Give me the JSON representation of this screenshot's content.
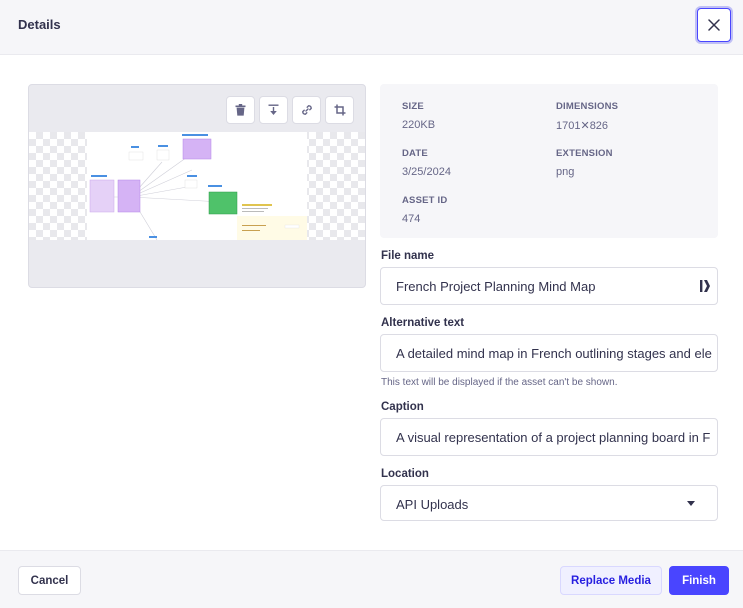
{
  "header": {
    "title": "Details",
    "close_icon": "close-icon"
  },
  "preview": {
    "toolbar": [
      {
        "name": "delete",
        "icon": "trash-icon"
      },
      {
        "name": "download",
        "icon": "download-icon"
      },
      {
        "name": "copy-link",
        "icon": "link-icon"
      },
      {
        "name": "crop",
        "icon": "crop-icon"
      }
    ]
  },
  "meta": {
    "size_label": "SIZE",
    "size_value": "220KB",
    "dimensions_label": "DIMENSIONS",
    "dimensions_value": "1701✕826",
    "date_label": "DATE",
    "date_value": "3/25/2024",
    "extension_label": "EXTENSION",
    "extension_value": "png",
    "asset_id_label": "ASSET ID",
    "asset_id_value": "474"
  },
  "form": {
    "file_name": {
      "label": "File name",
      "value": "French Project Planning Mind Map"
    },
    "alt_text": {
      "label": "Alternative text",
      "value": "A detailed mind map in French outlining stages and ele",
      "hint": "This text will be displayed if the asset can't be shown."
    },
    "caption": {
      "label": "Caption",
      "value": "A visual representation of a project planning board in F"
    },
    "location": {
      "label": "Location",
      "value": "API Uploads"
    }
  },
  "footer": {
    "cancel_label": "Cancel",
    "replace_label": "Replace Media",
    "finish_label": "Finish"
  },
  "colors": {
    "primary": "#4945ff",
    "primary_light": "#f0f0ff",
    "neutral_bg": "#f6f6f9",
    "text": "#32324d",
    "muted": "#666687"
  }
}
